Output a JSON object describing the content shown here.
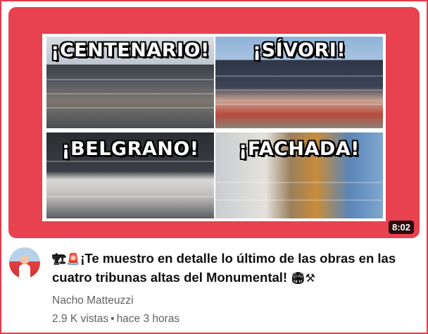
{
  "video": {
    "thumbnail": {
      "panels": [
        {
          "label": "¡CENTENARIO!"
        },
        {
          "label": "¡SÍVORI!"
        },
        {
          "label": "¡BELGRANO!"
        },
        {
          "label": "¡FACHADA!"
        }
      ],
      "duration": "8:02",
      "border_color": "#e8414f"
    },
    "title_emoji_start": "🏗🚨",
    "title_text": "¡Te muestro en detalle lo último de las obras en las cuatro tribunas altas del Monumental!",
    "title_emoji_end": "🏟⚒",
    "channel": "Nacho Matteuzzi",
    "views": "2.9 K vistas",
    "separator": "•",
    "age": "hace 3 horas"
  }
}
